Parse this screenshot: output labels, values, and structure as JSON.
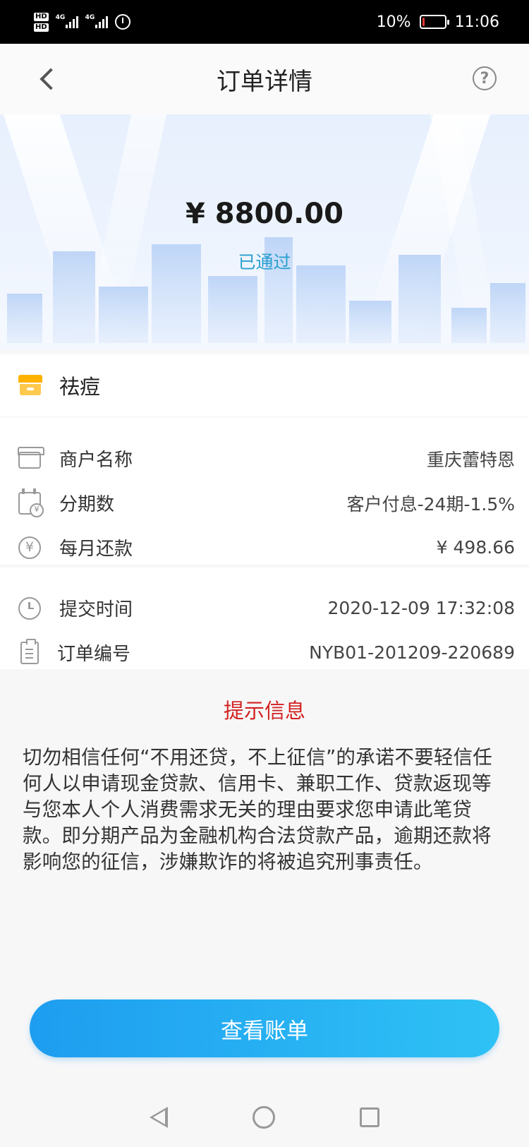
{
  "status_bar": {
    "battery": "10%",
    "time": "11:06",
    "battery_level": 0.1,
    "hd1": "HD",
    "hd2": "HD",
    "net1": "4G",
    "net2": "4G"
  },
  "nav": {
    "title": "订单详情",
    "help_icon": "?"
  },
  "banner": {
    "amount": "¥ 8800.00",
    "status": "已通过"
  },
  "product": {
    "name": "祛痘"
  },
  "details": [
    {
      "icon": "merchant-icon",
      "label": "商户名称",
      "value": "重庆蕾特恩"
    },
    {
      "icon": "calendar-icon",
      "label": "分期数",
      "value": "客户付息-24期-1.5%"
    },
    {
      "icon": "yen-icon",
      "label": "每月还款",
      "value": "¥ 498.66"
    }
  ],
  "order": [
    {
      "icon": "clock-icon",
      "label": "提交时间",
      "value": "2020-12-09 17:32:08"
    },
    {
      "icon": "list-icon",
      "label": "订单编号",
      "value": "NYB01-201209-220689"
    }
  ],
  "tips": {
    "title": "提示信息",
    "body": "切勿相信任何“不用还贷，不上征信”的承诺不要轻信任何人以申请现金贷款、信用卡、兼职工作、贷款返现等与您本人个人消费需求无关的理由要求您申请此笔贷款。即分期产品为金融机构合法贷款产品，逾期还款将影响您的征信，涉嫌欺诈的将被追究刑事责任。"
  },
  "button": {
    "label": "查看账单"
  },
  "colors": {
    "accent": "#2a9fd0",
    "warning": "#d32020",
    "button_start": "#1e9df0",
    "button_end": "#2fc2f5",
    "store_icon": "#ffb300"
  }
}
